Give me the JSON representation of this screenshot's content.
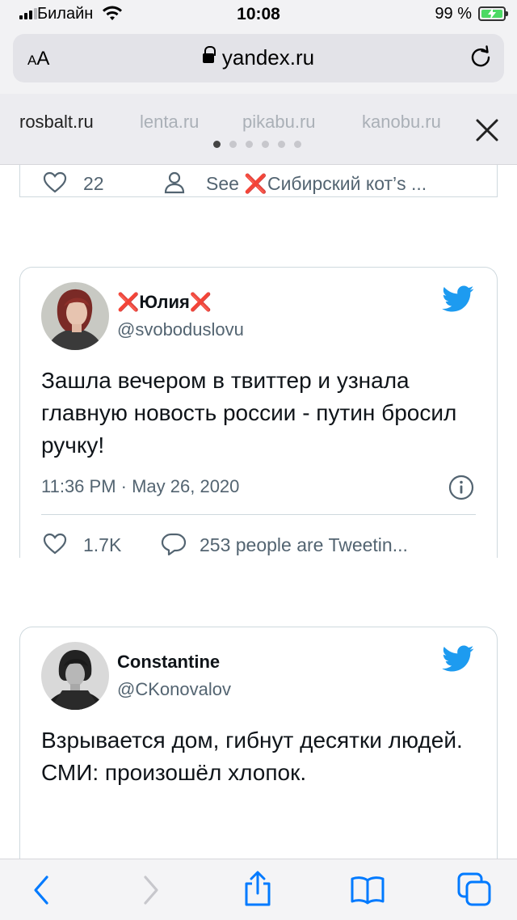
{
  "status_bar": {
    "carrier": "Билайн",
    "time": "10:08",
    "battery_percent": "99 %"
  },
  "browser": {
    "text_size_label_small": "A",
    "text_size_label_large": "A",
    "url": "yandex.ru"
  },
  "tabs": {
    "items": [
      "rosbalt.ru",
      "lenta.ru",
      "pikabu.ru",
      "kanobu.ru"
    ],
    "active_index": 0
  },
  "prev_card": {
    "likes": "22",
    "see_prefix": "See ",
    "see_user": "Сибирский кот’s ..."
  },
  "tweet1": {
    "author_name": "Юлия",
    "handle": "@svoboduslovu",
    "text": "Зашла вечером в твиттер и узнала главную новость россии - путин бросил ручку!",
    "timestamp": "11:36 PM · May 26, 2020",
    "likes": "1.7K",
    "discussion": "253 people are Tweetin..."
  },
  "tweet2": {
    "author_name": "Constantine",
    "handle": "@CKonovalov",
    "text_line1": "Взрывается дом, гибнут десятки людей.",
    "text_line2": "СМИ: произошёл хлопок."
  },
  "colors": {
    "twitter_blue": "#1d9bf0",
    "safari_blue": "#007aff",
    "cross_red": "#dd2e44",
    "muted_text": "#536471"
  },
  "icons": {
    "tweet_brand": "twitter-bird-icon",
    "like": "heart-icon",
    "reply": "speech-bubble-icon",
    "info": "info-circle-icon",
    "profile": "person-icon"
  }
}
